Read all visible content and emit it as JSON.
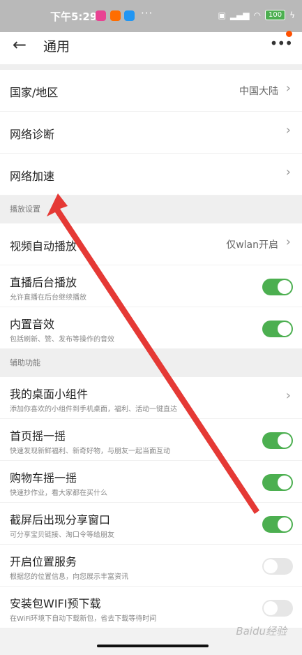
{
  "status": {
    "time": "下午5:29",
    "battery": "100",
    "dots": "···"
  },
  "header": {
    "title": "通用",
    "back": "←",
    "more": "•••"
  },
  "sections": [
    {
      "head": "",
      "items": [
        {
          "label": "国家/地区",
          "value": "中国大陆",
          "control": "chevron"
        },
        {
          "label": "网络诊断",
          "control": "chevron"
        },
        {
          "label": "网络加速",
          "control": "chevron"
        }
      ]
    },
    {
      "head": "播放设置",
      "items": [
        {
          "label": "视频自动播放",
          "value": "仅wlan开启",
          "control": "chevron"
        },
        {
          "label": "直播后台播放",
          "sub": "允许直播在后台继续播放",
          "control": "on"
        },
        {
          "label": "内置音效",
          "sub": "包括刷新、赞、发布等操作的音效",
          "control": "on"
        }
      ]
    },
    {
      "head": "辅助功能",
      "items": [
        {
          "label": "我的桌面小组件",
          "sub": "添加你喜欢的小组件到手机桌面，福利、活动一键直达",
          "control": "chevron"
        },
        {
          "label": "首页摇一摇",
          "sub": "快速发现新鲜福利、新奇好物，与朋友一起当面互动",
          "control": "on"
        },
        {
          "label": "购物车摇一摇",
          "sub": "快速抄作业，看大家都在买什么",
          "control": "on"
        },
        {
          "label": "截屏后出现分享窗口",
          "sub": "可分享宝贝链接、淘口令等给朋友",
          "control": "on"
        },
        {
          "label": "开启位置服务",
          "sub": "根据您的位置信息，向您展示丰富资讯",
          "control": "off"
        },
        {
          "label": "安装包WIFI预下载",
          "sub": "在WiFi环境下自动下载新包，省去下载等待时间",
          "control": "off"
        }
      ]
    }
  ],
  "watermark": "Baidu经验",
  "colors": {
    "toggle_on": "#4caf50",
    "toggle_off": "#e6e6e6",
    "annotation_arrow": "#e53935"
  }
}
